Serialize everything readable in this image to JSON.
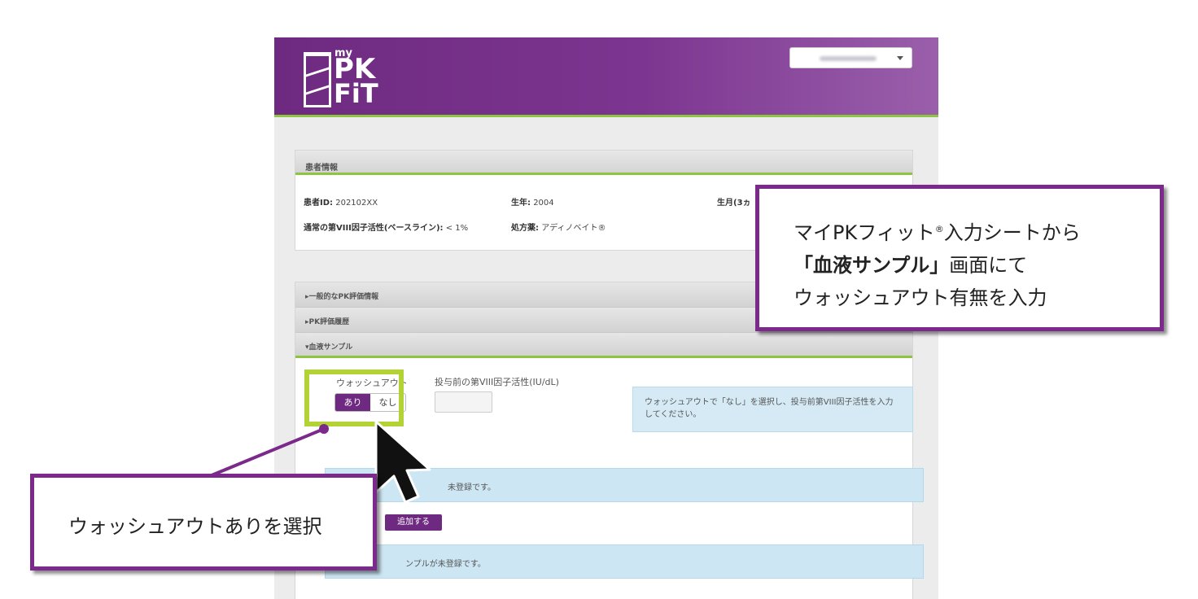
{
  "app": {
    "logo": {
      "my": "my",
      "pk": "PK",
      "fit": "FiT"
    },
    "patient_panel": {
      "title": "患者情報",
      "patient_id_label": "患者ID:",
      "patient_id_value": "202102XX",
      "birth_year_label": "生年:",
      "birth_year_value": "2004",
      "birth_month_label": "生月(3ヵ",
      "baseline_label": "通常の第VIII因子活性(ベースライン):",
      "baseline_value": "< 1%",
      "prescription_label": "処方薬:",
      "prescription_value": "アディノベイト®"
    },
    "accordion": {
      "general_pk": "▸一般的なPK評価情報",
      "pk_history": "▸PK評価履歴",
      "blood_sample": "▾血液サンプル"
    },
    "blood_sample": {
      "washout_label": "ウォッシュアウト",
      "washout_yes": "あり",
      "washout_no": "なし",
      "factor_label": "投与前の第VIII因子活性(IU/dL)",
      "factor_value": "",
      "hint": "ウォッシュアウトで「なし」を選択し、投与前第VIII因子活性を入力してください。",
      "alert1_tail": "未登録です。",
      "add_button": "追加する",
      "alert2_tail": "ンプルが未登録です。"
    }
  },
  "annotations": {
    "top_callout": {
      "line1_a": "マイPKフィット",
      "line1_reg": "®",
      "line1_b": "入力シートから",
      "line2_bold": "「血液サンプル」",
      "line2_rest": "画面にて",
      "line3": "ウォッシュアウト有無を入力"
    },
    "bottom_callout": {
      "text": "ウォッシュアウトありを選択"
    },
    "colors": {
      "callout_border": "#7b2a8c",
      "highlight": "#b2d235",
      "brand_purple": "#6e2a80",
      "accent_green": "#8cc63e"
    }
  }
}
